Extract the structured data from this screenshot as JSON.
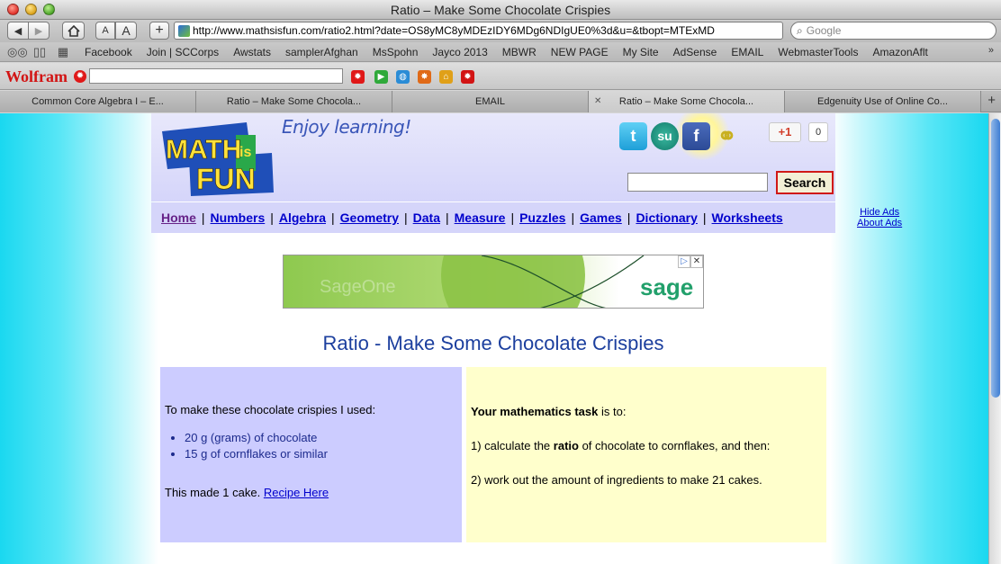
{
  "window": {
    "title": "Ratio – Make Some Chocolate Crispies"
  },
  "toolbar": {
    "back_icon": "back-arrow",
    "forward_icon": "forward-arrow",
    "home_icon": "home",
    "text_small": "A",
    "text_large": "A",
    "add_bookmark": "+",
    "url": "http://www.mathsisfun.com/ratio2.html?date=OS8yMC8yMDEzIDY6MDg6NDIgUE0%3d&u=&tbopt=MTExMD",
    "search_placeholder": "Google"
  },
  "bookmarks": {
    "items": [
      "Facebook",
      "Join | SCCorps",
      "Awstats",
      "samplerAfghan",
      "MsSpohn",
      "Jayco 2013",
      "MBWR",
      "NEW PAGE",
      "My Site",
      "AdSense",
      "EMAIL",
      "WebmasterTools",
      "AmazonAflt"
    ],
    "more": "»"
  },
  "wolfram": {
    "logo": "Wolfram"
  },
  "tabs": [
    {
      "label": "Common Core Algebra I – E..."
    },
    {
      "label": "Ratio – Make Some Chocola..."
    },
    {
      "label": "EMAIL"
    },
    {
      "label": "Ratio – Make Some Chocola..."
    },
    {
      "label": "Edgenuity Use of Online Co..."
    }
  ],
  "site": {
    "logo": {
      "line1": "MATH",
      "is": "is",
      "line2": "FUN"
    },
    "tagline": "Enjoy learning!",
    "gplus_label": "+1",
    "gplus_count": "0",
    "search_button": "Search",
    "nav": [
      "Home",
      "Numbers",
      "Algebra",
      "Geometry",
      "Data",
      "Measure",
      "Puzzles",
      "Games",
      "Dictionary",
      "Worksheets"
    ],
    "nav_sep": "|",
    "hide_ads": "Hide Ads",
    "about_ads": "About Ads"
  },
  "ad": {
    "brand": "sage",
    "faded_text": "SageOne"
  },
  "main": {
    "title": "Ratio - Make Some Chocolate Crispies",
    "left": {
      "intro": "To make these chocolate crispies I used:",
      "items": [
        "20 g (grams) of chocolate",
        "15 g of cornflakes or similar"
      ],
      "made": "This made 1 cake.",
      "recipe_link": "Recipe Here"
    },
    "right": {
      "task_bold": "Your mathematics task",
      "task_rest": " is to:",
      "step1_pre": "1) calculate the ",
      "step1_bold": "ratio",
      "step1_post": " of chocolate to cornflakes, and then:",
      "step2": "2) work out the amount of ingredients to make 21 cakes."
    }
  },
  "colors": {
    "accent_blue": "#1c3f9e",
    "link": "#0000cc",
    "nav_bg": "#d5d5fa",
    "left_box": "#ccccff",
    "right_box": "#ffffcc"
  }
}
